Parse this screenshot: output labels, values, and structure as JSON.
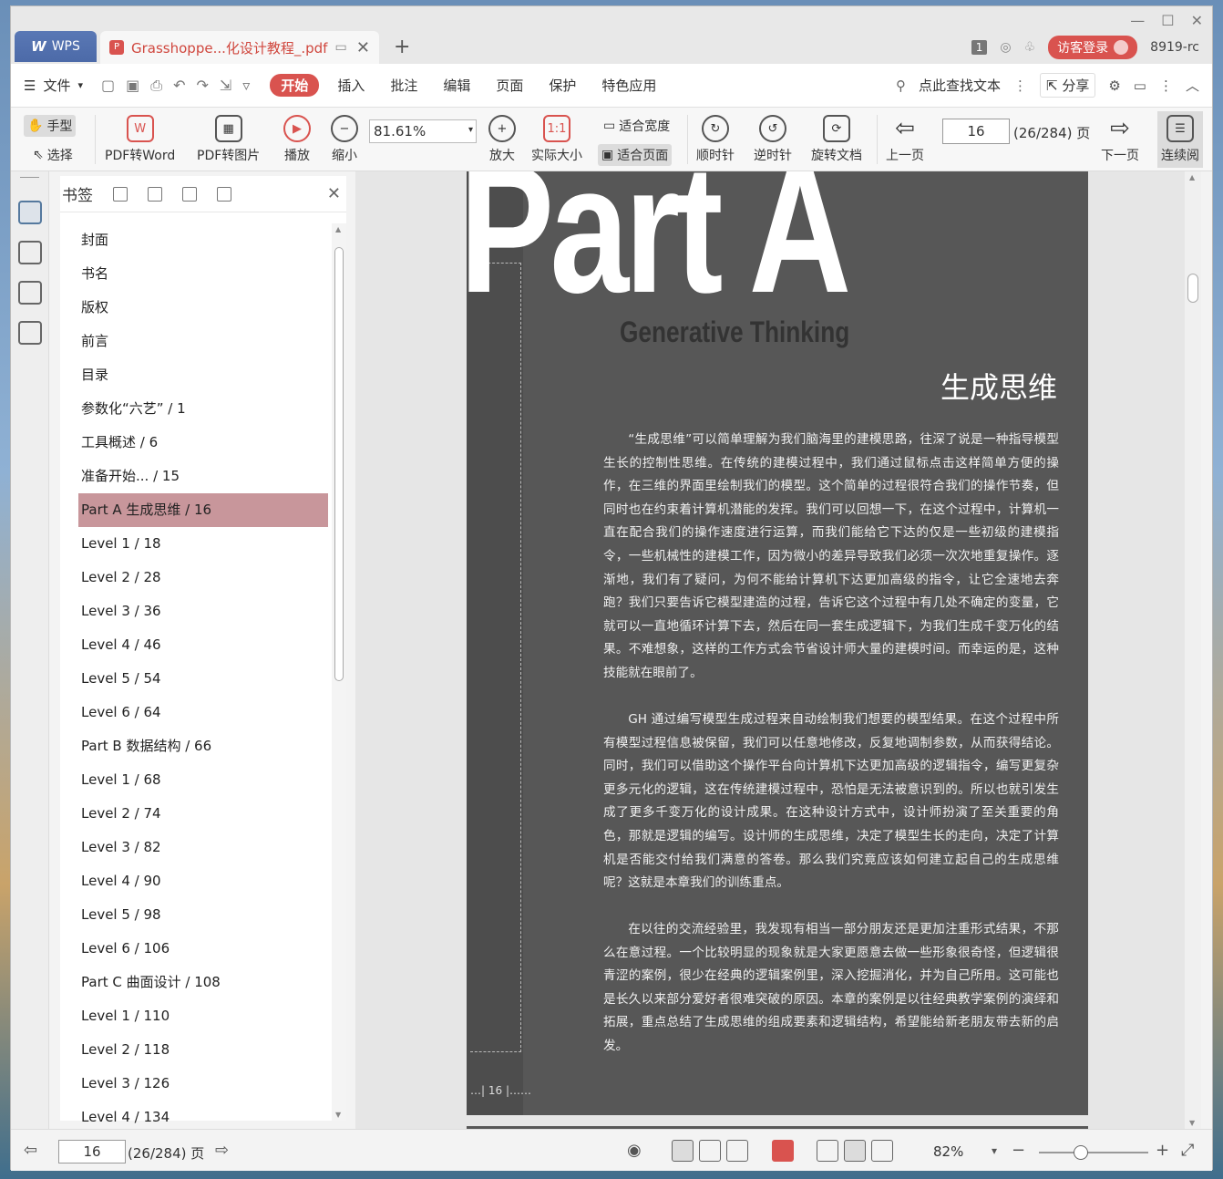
{
  "titlebar": {
    "wps_tab": "WPS",
    "doc_tab": "Grasshoppe...化设计教程_.pdf",
    "badge": "1",
    "login": "访客登录",
    "user": "8919-rc"
  },
  "menu": {
    "file": "文件",
    "items": [
      "开始",
      "插入",
      "批注",
      "编辑",
      "页面",
      "保护",
      "特色应用"
    ],
    "active_index": 0,
    "search": "点此查找文本",
    "share": "分享"
  },
  "ribbon": {
    "hand": "手型",
    "select": "选择",
    "pdf_to_word": "PDF转Word",
    "pdf_to_image": "PDF转图片",
    "play": "播放",
    "zoom_out": "缩小",
    "zoom_value": "81.61%",
    "zoom_in": "放大",
    "actual_size": "实际大小",
    "fit_width": "适合宽度",
    "fit_page": "适合页面",
    "clockwise": "顺时针",
    "counterclockwise": "逆时针",
    "rotate_doc": "旋转文档",
    "prev_page": "上一页",
    "page_number": "16",
    "page_total": "(26/284) 页",
    "next_page": "下一页",
    "continuous": "连续阅"
  },
  "bookmarks": {
    "title": "书签",
    "selected_index": 8,
    "items": [
      "封面",
      "书名",
      "版权",
      "前言",
      "目录",
      "参数化“六艺” / 1",
      "工具概述 / 6",
      "准备开始... / 15",
      "Part A  生成思维 / 16",
      "Level 1 / 18",
      "Level 2 / 28",
      "Level 3 / 36",
      "Level 4 / 46",
      "Level 5 / 54",
      "Level 6 / 64",
      "Part B  数据结构 / 66",
      "Level 1 / 68",
      "Level 2 / 74",
      "Level 3 / 82",
      "Level 4 / 90",
      "Level 5 / 98",
      "Level 6 / 106",
      "Part C  曲面设计 / 108",
      "Level 1 / 110",
      "Level 2 / 118",
      "Level 3 / 126",
      "Level 4 / 134"
    ]
  },
  "page": {
    "big_title": "Part A",
    "subtitle_en": "Generative Thinking",
    "title_cn": "生成思维",
    "paragraphs": [
      "“生成思维”可以简单理解为我们脑海里的建模思路，往深了说是一种指导模型生长的控制性思维。在传统的建模过程中，我们通过鼠标点击这样简单方便的操作，在三维的界面里绘制我们的模型。这个简单的过程很符合我们的操作节奏，但同时也在约束着计算机潜能的发挥。我们可以回想一下，在这个过程中，计算机一直在配合我们的操作速度进行运算，而我们能给它下达的仅是一些初级的建模指令，一些机械性的建模工作，因为微小的差异导致我们必须一次次地重复操作。逐渐地，我们有了疑问，为何不能给计算机下达更加高级的指令，让它全速地去奔跑？我们只要告诉它模型建造的过程，告诉它这个过程中有几处不确定的变量，它就可以一直地循环计算下去，然后在同一套生成逻辑下，为我们生成千变万化的结果。不难想象，这样的工作方式会节省设计师大量的建模时间。而幸运的是，这种技能就在眼前了。",
      "GH 通过编写模型生成过程来自动绘制我们想要的模型结果。在这个过程中所有模型过程信息被保留，我们可以任意地修改，反复地调制参数，从而获得结论。同时，我们可以借助这个操作平台向计算机下达更加高级的逻辑指令，编写更复杂更多元化的逻辑，这在传统建模过程中，恐怕是无法被意识到的。所以也就引发生成了更多千变万化的设计成果。在这种设计方式中，设计师扮演了至关重要的角色，那就是逻辑的编写。设计师的生成思维，决定了模型生长的走向，决定了计算机是否能交付给我们满意的答卷。那么我们究竟应该如何建立起自己的生成思维呢？这就是本章我们的训练重点。",
      "在以往的交流经验里，我发现有相当一部分朋友还是更加注重形式结果，不那么在意过程。一个比较明显的现象就是大家更愿意去做一些形象很奇怪，但逻辑很青涩的案例，很少在经典的逻辑案例里，深入挖掘消化，并为自己所用。这可能也是长久以来部分爱好者很难突破的原因。本章的案例是以往经典教学案例的演绎和拓展，重点总结了生成思维的组成要素和逻辑结构，希望能给新老朋友带去新的启发。"
    ],
    "page_marker": "16"
  },
  "status": {
    "page_number": "16",
    "page_total": "(26/284) 页",
    "zoom": "82%"
  },
  "colors": {
    "accent": "#d9534f",
    "bookmark_selected": "#c8969b",
    "page_bg": "#575757"
  }
}
